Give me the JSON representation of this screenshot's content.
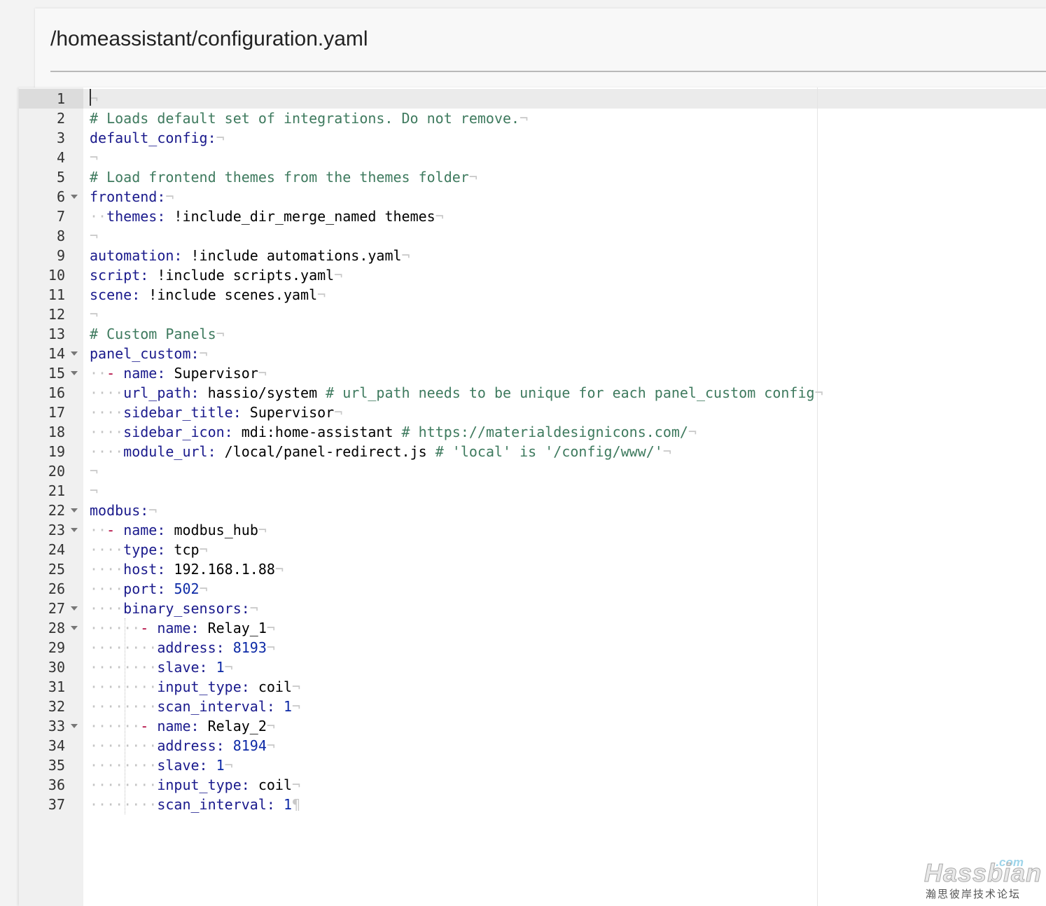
{
  "header": {
    "file_path": "/homeassistant/configuration.yaml"
  },
  "editor": {
    "fold_lines": [
      6,
      14,
      15,
      22,
      23,
      27,
      28,
      33
    ],
    "lines": [
      [],
      [
        {
          "t": "cmt",
          "v": "# Loads default set of integrations. Do not remove."
        }
      ],
      [
        {
          "t": "key",
          "v": "default_config:"
        }
      ],
      [],
      [
        {
          "t": "cmt",
          "v": "# Load frontend themes from the themes folder"
        }
      ],
      [
        {
          "t": "key",
          "v": "frontend:"
        }
      ],
      [
        {
          "t": "ws",
          "v": "  "
        },
        {
          "t": "key",
          "v": "themes:"
        },
        {
          "t": "txt",
          "v": " !include_dir_merge_named themes"
        }
      ],
      [],
      [
        {
          "t": "key",
          "v": "automation:"
        },
        {
          "t": "txt",
          "v": " !include automations.yaml"
        }
      ],
      [
        {
          "t": "key",
          "v": "script:"
        },
        {
          "t": "txt",
          "v": " !include scripts.yaml"
        }
      ],
      [
        {
          "t": "key",
          "v": "scene:"
        },
        {
          "t": "txt",
          "v": " !include scenes.yaml"
        }
      ],
      [],
      [
        {
          "t": "cmt",
          "v": "# Custom Panels"
        }
      ],
      [
        {
          "t": "key",
          "v": "panel_custom:"
        }
      ],
      [
        {
          "t": "ws",
          "v": "  "
        },
        {
          "t": "dash",
          "v": "-"
        },
        {
          "t": "txt",
          "v": " "
        },
        {
          "t": "key",
          "v": "name:"
        },
        {
          "t": "txt",
          "v": " Supervisor"
        }
      ],
      [
        {
          "t": "ws",
          "v": "    "
        },
        {
          "t": "key",
          "v": "url_path:"
        },
        {
          "t": "txt",
          "v": " hassio/system "
        },
        {
          "t": "cmt",
          "v": "# url_path needs to be unique for each panel_custom config"
        }
      ],
      [
        {
          "t": "ws",
          "v": "    "
        },
        {
          "t": "key",
          "v": "sidebar_title:"
        },
        {
          "t": "txt",
          "v": " Supervisor"
        }
      ],
      [
        {
          "t": "ws",
          "v": "    "
        },
        {
          "t": "key",
          "v": "sidebar_icon:"
        },
        {
          "t": "txt",
          "v": " mdi:home-assistant "
        },
        {
          "t": "cmt",
          "v": "# https://materialdesignicons.com/"
        }
      ],
      [
        {
          "t": "ws",
          "v": "    "
        },
        {
          "t": "key",
          "v": "module_url:"
        },
        {
          "t": "txt",
          "v": " /local/panel-redirect.js "
        },
        {
          "t": "cmt",
          "v": "# 'local' is '/config/www/'"
        }
      ],
      [],
      [],
      [
        {
          "t": "key",
          "v": "modbus:"
        }
      ],
      [
        {
          "t": "ws",
          "v": "  "
        },
        {
          "t": "dash",
          "v": "-"
        },
        {
          "t": "txt",
          "v": " "
        },
        {
          "t": "key",
          "v": "name:"
        },
        {
          "t": "txt",
          "v": " modbus_hub"
        }
      ],
      [
        {
          "t": "ws",
          "v": "    "
        },
        {
          "t": "key",
          "v": "type:"
        },
        {
          "t": "txt",
          "v": " tcp"
        }
      ],
      [
        {
          "t": "ws",
          "v": "    "
        },
        {
          "t": "key",
          "v": "host:"
        },
        {
          "t": "txt",
          "v": " 192.168.1.88"
        }
      ],
      [
        {
          "t": "ws",
          "v": "    "
        },
        {
          "t": "key",
          "v": "port:"
        },
        {
          "t": "txt",
          "v": " "
        },
        {
          "t": "num",
          "v": "502"
        }
      ],
      [
        {
          "t": "ws",
          "v": "    "
        },
        {
          "t": "key",
          "v": "binary_sensors:"
        }
      ],
      [
        {
          "t": "ws",
          "v": "      "
        },
        {
          "t": "dash",
          "v": "-"
        },
        {
          "t": "txt",
          "v": " "
        },
        {
          "t": "key",
          "v": "name:"
        },
        {
          "t": "txt",
          "v": " Relay_1"
        }
      ],
      [
        {
          "t": "ws",
          "v": "        "
        },
        {
          "t": "key",
          "v": "address:"
        },
        {
          "t": "txt",
          "v": " "
        },
        {
          "t": "num",
          "v": "8193"
        }
      ],
      [
        {
          "t": "ws",
          "v": "        "
        },
        {
          "t": "key",
          "v": "slave:"
        },
        {
          "t": "txt",
          "v": " "
        },
        {
          "t": "num",
          "v": "1"
        }
      ],
      [
        {
          "t": "ws",
          "v": "        "
        },
        {
          "t": "key",
          "v": "input_type:"
        },
        {
          "t": "txt",
          "v": " coil"
        }
      ],
      [
        {
          "t": "ws",
          "v": "        "
        },
        {
          "t": "key",
          "v": "scan_interval:"
        },
        {
          "t": "txt",
          "v": " "
        },
        {
          "t": "num",
          "v": "1"
        }
      ],
      [
        {
          "t": "ws",
          "v": "      "
        },
        {
          "t": "dash",
          "v": "-"
        },
        {
          "t": "txt",
          "v": " "
        },
        {
          "t": "key",
          "v": "name:"
        },
        {
          "t": "txt",
          "v": " Relay_2"
        }
      ],
      [
        {
          "t": "ws",
          "v": "        "
        },
        {
          "t": "key",
          "v": "address:"
        },
        {
          "t": "txt",
          "v": " "
        },
        {
          "t": "num",
          "v": "8194"
        }
      ],
      [
        {
          "t": "ws",
          "v": "        "
        },
        {
          "t": "key",
          "v": "slave:"
        },
        {
          "t": "txt",
          "v": " "
        },
        {
          "t": "num",
          "v": "1"
        }
      ],
      [
        {
          "t": "ws",
          "v": "        "
        },
        {
          "t": "key",
          "v": "input_type:"
        },
        {
          "t": "txt",
          "v": " coil"
        }
      ],
      [
        {
          "t": "ws",
          "v": "        "
        },
        {
          "t": "key",
          "v": "scan_interval:"
        },
        {
          "t": "txt",
          "v": " "
        },
        {
          "t": "num",
          "v": "1"
        }
      ]
    ]
  },
  "watermark": {
    "brand": "Hassbian",
    "tld": ".com",
    "subtitle": "瀚思彼岸技术论坛"
  },
  "colors": {
    "key": "#1a1a8c",
    "comment": "#3e7a5e",
    "number": "#0d2aa6",
    "dash": "#b0003a"
  }
}
